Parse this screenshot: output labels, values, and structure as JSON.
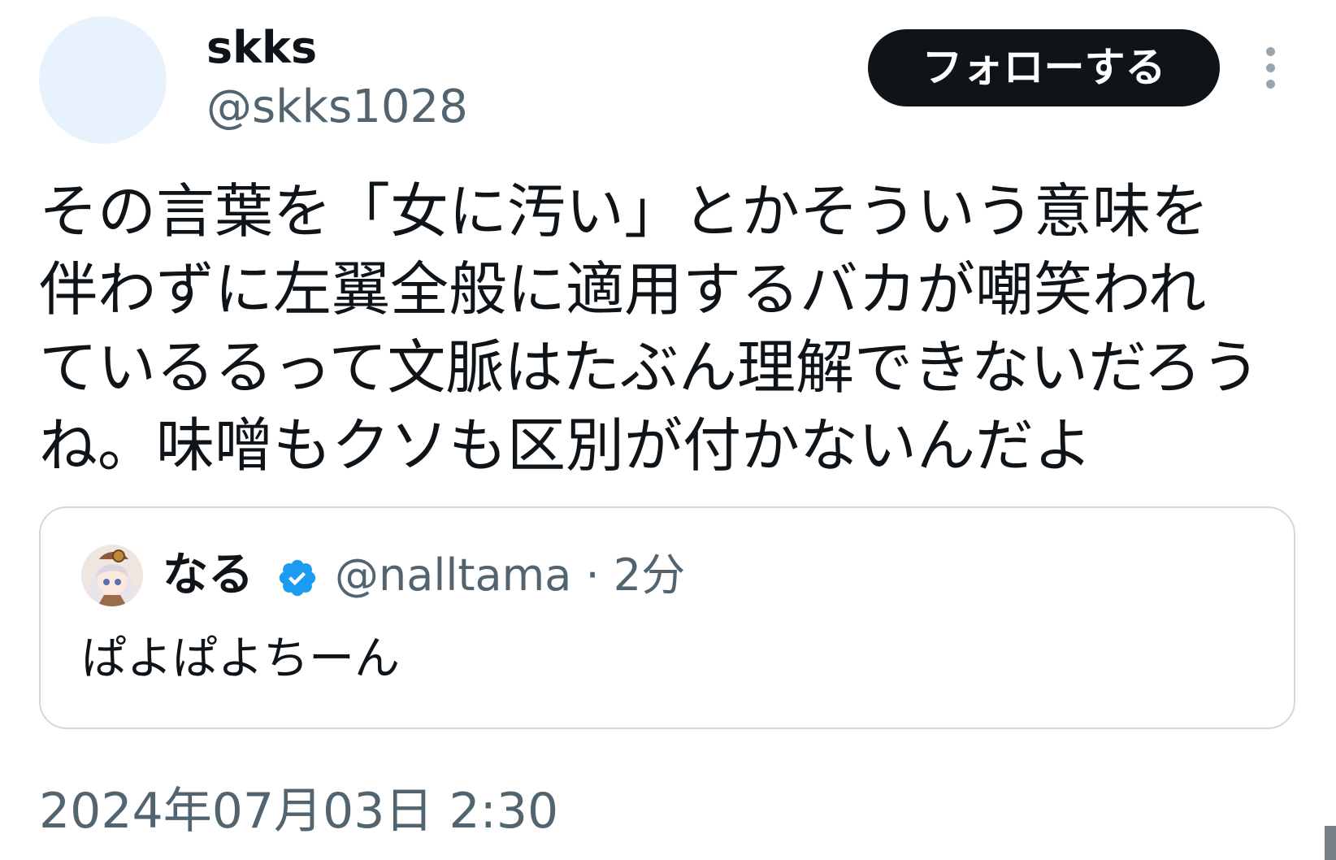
{
  "author": {
    "display_name": "skks",
    "handle": "@skks1028"
  },
  "actions": {
    "follow_label": "フォローする",
    "more_icon": "more-vertical-icon"
  },
  "tweet": {
    "text": "その言葉を「女に汚い」とかそういう意味を\n伴わずに左翼全般に適用するバカが嘲笑われ\nているるって文脈はたぶん理解できないだろう\nね。味噌もクソも区別が付かないんだよ",
    "timestamp": "2024年07月03日 2:30"
  },
  "quote": {
    "display_name": "なる",
    "verified_icon": "verified-badge-icon",
    "meta": "@nalltama · 2分",
    "text": "ぱよぱよちーん"
  },
  "colors": {
    "text_primary": "#0f1419",
    "text_secondary": "#536471",
    "follow_bg": "#0f1419",
    "verified_blue": "#1d9bf0",
    "border": "#cfd9de"
  }
}
